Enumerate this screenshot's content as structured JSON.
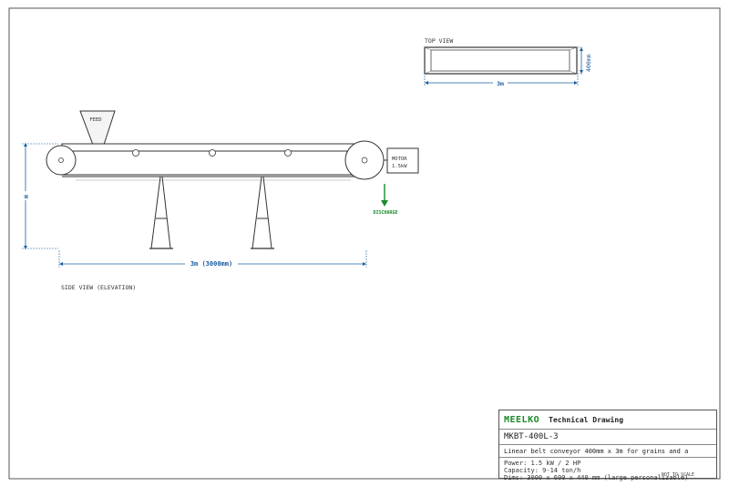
{
  "drawing": {
    "top_view": {
      "title": "TOP VIEW",
      "width_label": "400mm",
      "length_label": "3m"
    },
    "side_view": {
      "title": "SIDE VIEW (ELEVATION)",
      "feed_label": "FEED",
      "motor_label": "MOTOR",
      "motor_power": "1.5kW",
      "discharge_label": "DISCHARGE",
      "height_label": "H",
      "length_label": "3m (3000mm)"
    }
  },
  "title_block": {
    "brand": "MEELKO",
    "doc_type": "Technical Drawing",
    "model": "MKBT-400L-3",
    "description": "Linear belt conveyor 400mm x 3m for grains and a",
    "specs": [
      "Power: 1.5 kW / 2 HP",
      "Capacity: 9-14 ton/h",
      "Dims: 3000 x 600 x 440 mm (large personalizable)"
    ],
    "scale_note": "NOT TO SCALE"
  },
  "colors": {
    "dimension": "#1a5fa0",
    "discharge": "#1a8a2a",
    "line": "#333333"
  }
}
